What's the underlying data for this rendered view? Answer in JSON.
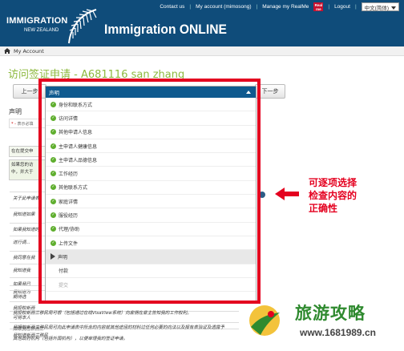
{
  "header": {
    "logo_line1": "IMMIGRATION",
    "logo_line2": "NEW ZEALAND",
    "app_title": "Immigration ONLINE",
    "nav": {
      "contact": "Contact us",
      "account": "My account (mimosong)",
      "realme": "Manage my RealMe",
      "realme_badge": "Real me",
      "logout": "Logout",
      "language": "中文(简体)"
    }
  },
  "breadcrumb": {
    "home_icon": "home-icon",
    "label": "My Account"
  },
  "page": {
    "title": "访问签证申请 - A681116 san zhang",
    "prev_button": "上一步",
    "next_button": "下一步",
    "section_title": "声明",
    "required_note_star": "* -",
    "required_note": "表示必填",
    "green_box1": "在在提交申",
    "green_box2a": "如果您的访",
    "green_box2b": "中，并大于",
    "bg_lines": [
      "关于此申请表",
      "我知道如果",
      "如果我知道的",
      "进行调...",
      "我同意在我",
      "我知道我",
      "如果我已",
      "我知道为",
      "期待选",
      "我授权新西",
      "可将本人",
      "如果我在新西兰",
      "我知道新西兰移民"
    ],
    "bg_wide": [
      "我授权新西兰移民局可根（包括通过在线VisaView系统）向雇佣在雇主告知我的工作权利。",
      "我授权新西兰移民局可向此申请表中所含的内容就其他途径的材料过任何必要的向法以及报有表验证及透露予",
      "其他政府机构（包括外国机构），以便审理我的签证申请。"
    ]
  },
  "dropdown": {
    "selected": "声明",
    "options": [
      {
        "label": "身份和联系方式",
        "state": "done"
      },
      {
        "label": "访问详情",
        "state": "done"
      },
      {
        "label": "其他申请人信息",
        "state": "done"
      },
      {
        "label": "主申请人健康信息",
        "state": "done"
      },
      {
        "label": "主申请人品德信息",
        "state": "done"
      },
      {
        "label": "工作经历",
        "state": "done"
      },
      {
        "label": "其他联系方式",
        "state": "done"
      },
      {
        "label": "家庭详情",
        "state": "done"
      },
      {
        "label": "服役经历",
        "state": "done"
      },
      {
        "label": "代理/协助",
        "state": "done"
      },
      {
        "label": "上传文件",
        "state": "done"
      },
      {
        "label": "声明",
        "state": "current"
      },
      {
        "label": "付款",
        "state": "none"
      },
      {
        "label": "提交",
        "state": "none"
      }
    ]
  },
  "annotation": {
    "lines": [
      "可逐项选择",
      "检查内容的",
      "正确性"
    ]
  },
  "watermark": {
    "text": "旅游攻略",
    "url": "www.1681989.cn"
  },
  "colors": {
    "header": "#0f4c7a",
    "title_green": "#8db93e",
    "annotation_red": "#e4001f",
    "check_green": "#5fae2e"
  }
}
